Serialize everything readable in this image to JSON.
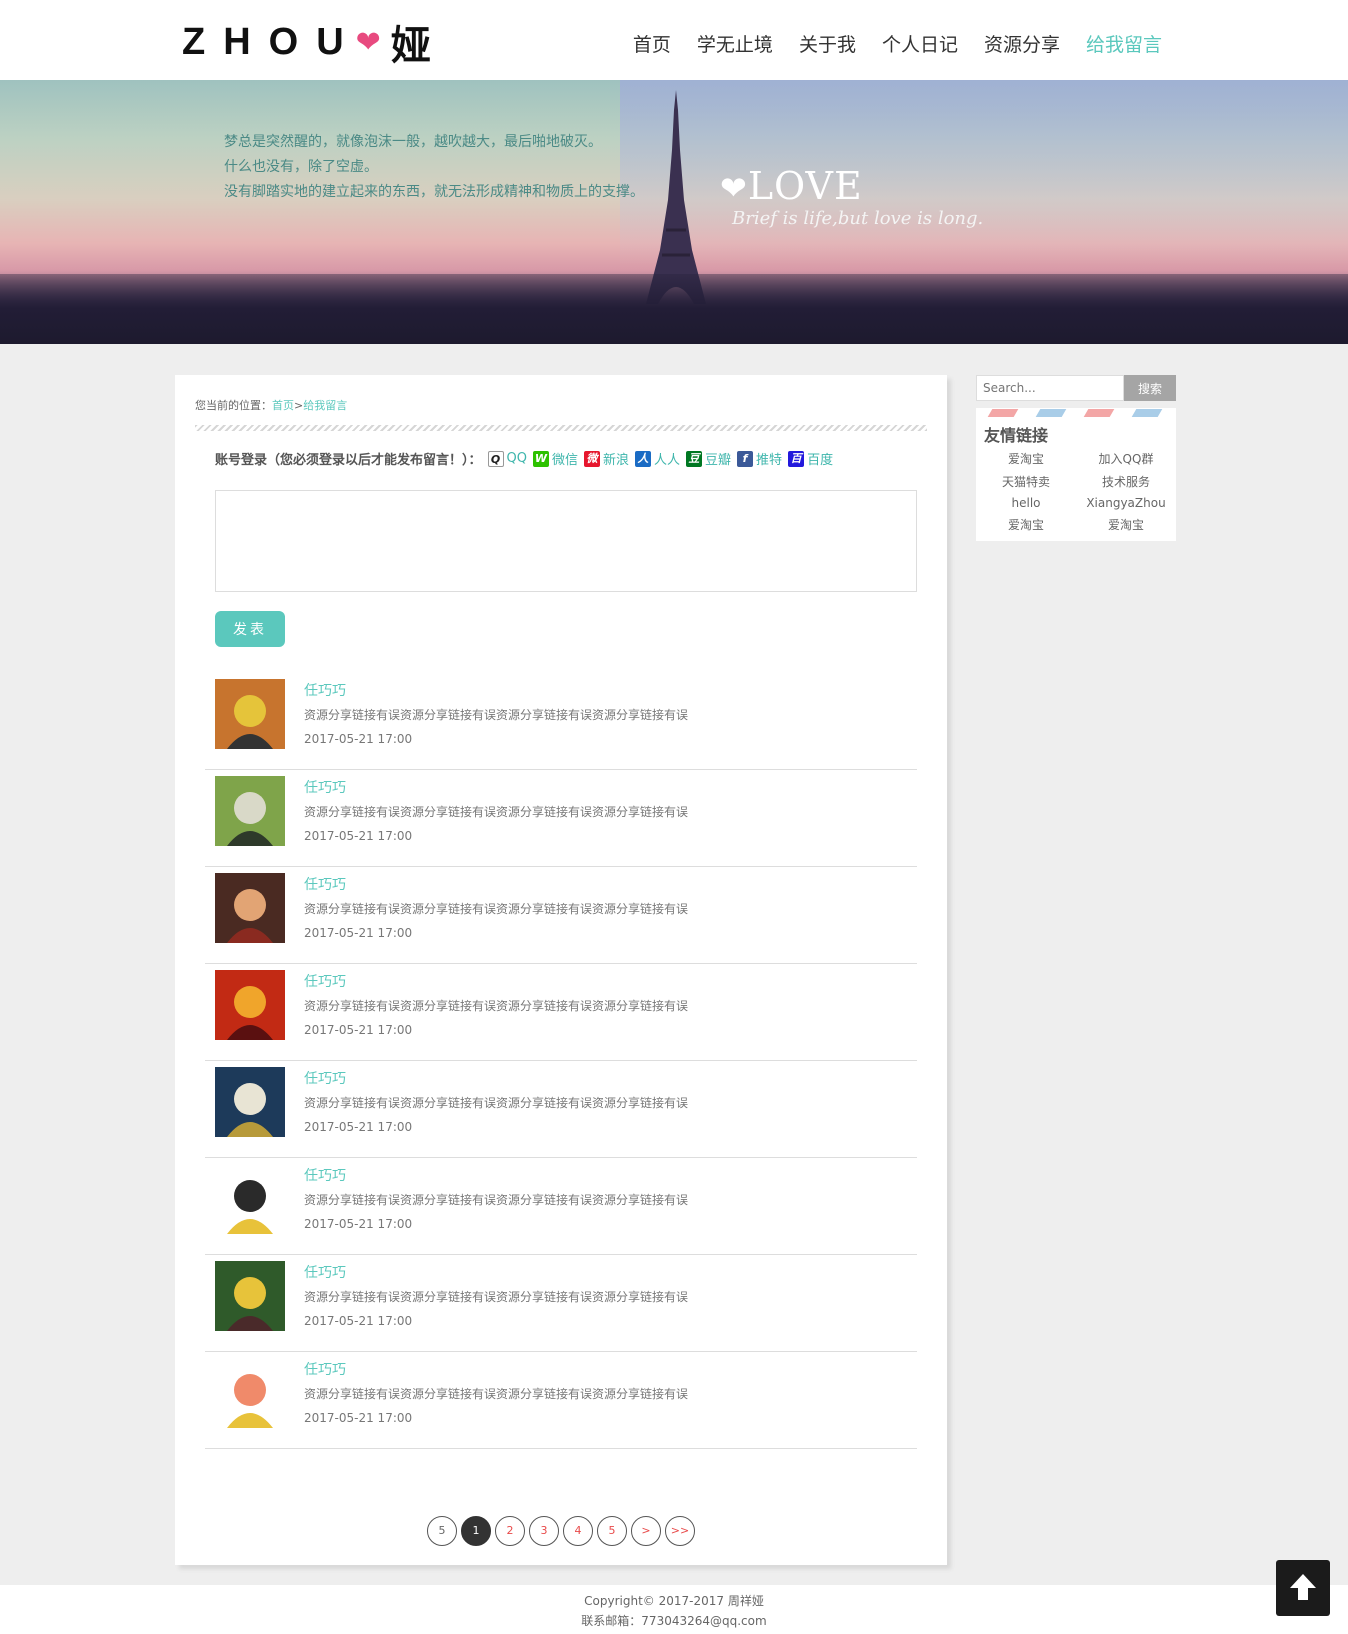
{
  "logo": {
    "text": "ZHOU",
    "cn": "娅"
  },
  "nav": [
    "首页",
    "学无止境",
    "关于我",
    "个人日记",
    "资源分享",
    "给我留言"
  ],
  "banner": {
    "lines": [
      "梦总是突然醒的，就像泡沫一般，越吹越大，最后啪地破灭。",
      "什么也没有，除了空虚。",
      "没有脚踏实地的建立起来的东西，就无法形成精神和物质上的支撑。"
    ],
    "love": "LOVE",
    "love_sub": "Brief is life,but love is long."
  },
  "breadcrumb": {
    "prefix": "您当前的位置：",
    "home": "首页",
    "sep": ">",
    "current": "给我留言"
  },
  "login": {
    "label": "账号登录（您必须登录以后才能发布留言！）：",
    "providers": [
      {
        "name": "QQ",
        "color": "#222222"
      },
      {
        "name": "微信",
        "color": "#2dc100"
      },
      {
        "name": "新浪",
        "color": "#e6162d"
      },
      {
        "name": "人人",
        "color": "#1a6bc4"
      },
      {
        "name": "豆瓣",
        "color": "#007722"
      },
      {
        "name": "推特",
        "color": "#3b5998"
      },
      {
        "name": "百度",
        "color": "#2319dc"
      }
    ]
  },
  "post_button": "发表",
  "messages": [
    {
      "name": "任巧巧",
      "content": "资源分享链接有误资源分享链接有误资源分享链接有误资源分享链接有误",
      "time": "2017-05-21 17:00",
      "avatar_colors": [
        "#c7742e",
        "#e5c43a",
        "#333333"
      ]
    },
    {
      "name": "任巧巧",
      "content": "资源分享链接有误资源分享链接有误资源分享链接有误资源分享链接有误",
      "time": "2017-05-21 17:00",
      "avatar_colors": [
        "#7fa44a",
        "#d9d9c8",
        "#2e3a2a"
      ]
    },
    {
      "name": "任巧巧",
      "content": "资源分享链接有误资源分享链接有误资源分享链接有误资源分享链接有误",
      "time": "2017-05-21 17:00",
      "avatar_colors": [
        "#4a2a22",
        "#e2a474",
        "#8a2a20"
      ]
    },
    {
      "name": "任巧巧",
      "content": "资源分享链接有误资源分享链接有误资源分享链接有误资源分享链接有误",
      "time": "2017-05-21 17:00",
      "avatar_colors": [
        "#c22a14",
        "#f0a52b",
        "#5a1010"
      ]
    },
    {
      "name": "任巧巧",
      "content": "资源分享链接有误资源分享链接有误资源分享链接有误资源分享链接有误",
      "time": "2017-05-21 17:00",
      "avatar_colors": [
        "#1d3a5a",
        "#e8e4d4",
        "#b79a3a"
      ]
    },
    {
      "name": "任巧巧",
      "content": "资源分享链接有误资源分享链接有误资源分享链接有误资源分享链接有误",
      "time": "2017-05-21 17:00",
      "avatar_colors": [
        "#ffffff",
        "#2a2a2a",
        "#e8c23a"
      ]
    },
    {
      "name": "任巧巧",
      "content": "资源分享链接有误资源分享链接有误资源分享链接有误资源分享链接有误",
      "time": "2017-05-21 17:00",
      "avatar_colors": [
        "#2f5a2a",
        "#e7c33a",
        "#4a2a2a"
      ]
    },
    {
      "name": "任巧巧",
      "content": "资源分享链接有误资源分享链接有误资源分享链接有误资源分享链接有误",
      "time": "2017-05-21 17:00",
      "avatar_colors": [
        "#ffffff",
        "#f08a6a",
        "#e8c23a"
      ]
    }
  ],
  "pagination": [
    "5",
    "1",
    "2",
    "3",
    "4",
    "5",
    ">",
    ">>"
  ],
  "search": {
    "placeholder": "Search...",
    "button": "搜索"
  },
  "friend_links": {
    "title": "友情链接",
    "items": [
      "爱淘宝",
      "加入QQ群",
      "天猫特卖",
      "技术服务",
      "hello",
      "XiangyaZhou",
      "爱淘宝",
      "爱淘宝"
    ]
  },
  "footer": {
    "copyright": "Copyright© 2017-2017 周祥娅",
    "email": "联系邮箱：773043264@qq.com"
  },
  "colors": {
    "accent": "#5bc8bd",
    "heart": "#e84a7f"
  }
}
